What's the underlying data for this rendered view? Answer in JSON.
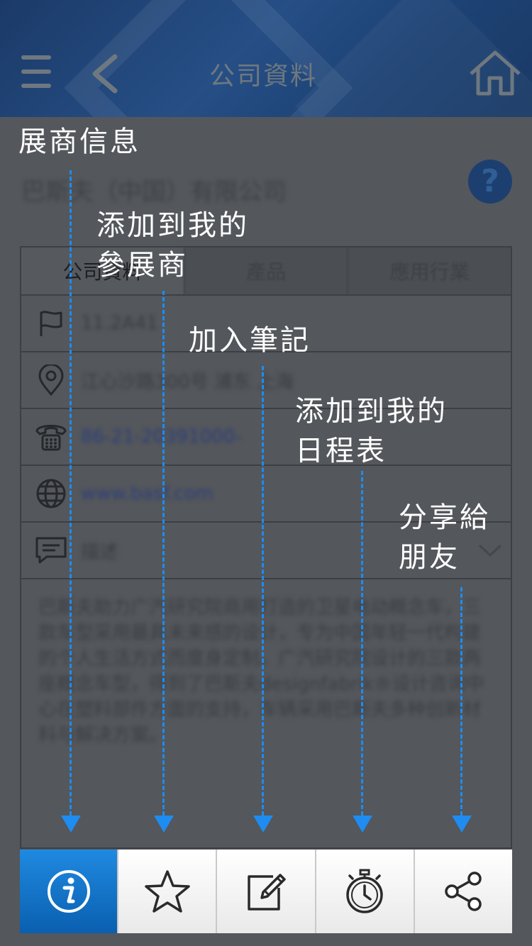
{
  "header": {
    "title": "公司資料",
    "menu_icon": "hamburger-menu-icon",
    "back_icon": "chevron-left-icon",
    "home_icon": "home-icon"
  },
  "company": {
    "name": "巴斯夫（中国）有限公司"
  },
  "tabs": [
    "公司資料",
    "產品",
    "應用行業"
  ],
  "details": {
    "booth": "11.2A41",
    "address": "江心沙路300号 浦东 上海",
    "phone": "86-21-20391000-",
    "website": "www.basf.com",
    "description_label": "描述",
    "description": "巴斯夫助力广汽研究院商用打造的卫星电动概念车，三款车型采用最具未来感的设计，专为中国年轻一代构建的个人生活方式而度身定制。广汽研究院设计的三款两座概念车型，得到了巴斯夫designfabrik®设计咨询中心在塑料部件方面的支持，车辆采用巴斯夫多种创新材料与解决方案。"
  },
  "tutorial": {
    "exhibitor_info": "展商信息",
    "add_to_exhibitors": "添加到我的\n參展商",
    "add_note": "加入筆記",
    "add_to_schedule": "添加到我的\n日程表",
    "share": "分享給\n朋友"
  },
  "toolbar": {
    "icons": [
      "info-icon",
      "star-icon",
      "note-edit-icon",
      "stopwatch-icon",
      "share-icon"
    ]
  },
  "colors": {
    "accent_blue": "#1e8cf0",
    "header_blue": "#1f4479",
    "toolbar_active": "#0b67c0"
  }
}
